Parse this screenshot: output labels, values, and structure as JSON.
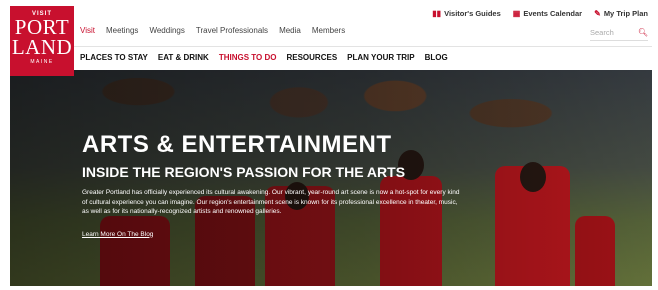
{
  "logo": {
    "top": "VISIT",
    "line1": "PORT",
    "line2": "LAND",
    "bottom": "MAINE"
  },
  "utility": [
    {
      "icon": "book-icon",
      "glyph": "▮▮",
      "label": "Visitor's Guides"
    },
    {
      "icon": "calendar-icon",
      "glyph": "▦",
      "label": "Events Calendar"
    },
    {
      "icon": "pencil-icon",
      "glyph": "✎",
      "label": "My Trip Plan"
    }
  ],
  "primary_nav": [
    "Visit",
    "Meetings",
    "Weddings",
    "Travel Professionals",
    "Media",
    "Members"
  ],
  "primary_active": "Visit",
  "search": {
    "placeholder": "Search"
  },
  "secondary_nav": [
    "PLACES TO STAY",
    "EAT & DRINK",
    "THINGS TO DO",
    "RESOURCES",
    "PLAN YOUR TRIP",
    "BLOG"
  ],
  "secondary_active": "THINGS TO DO",
  "hero": {
    "title": "ARTS & ENTERTAINMENT",
    "subtitle": "INSIDE THE REGION'S PASSION FOR THE ARTS",
    "description": "Greater Portland has officially experienced its cultural awakening. Our vibrant, year-round art scene is now a hot-spot for every kind of cultural experience you can imagine. Our region's entertainment scene is known for its professional excellence in theater, music, as well as for its nationally-recognized artists and renowned galleries.",
    "link": "Learn More On The Blog"
  },
  "colors": {
    "brand": "#c8102e"
  }
}
